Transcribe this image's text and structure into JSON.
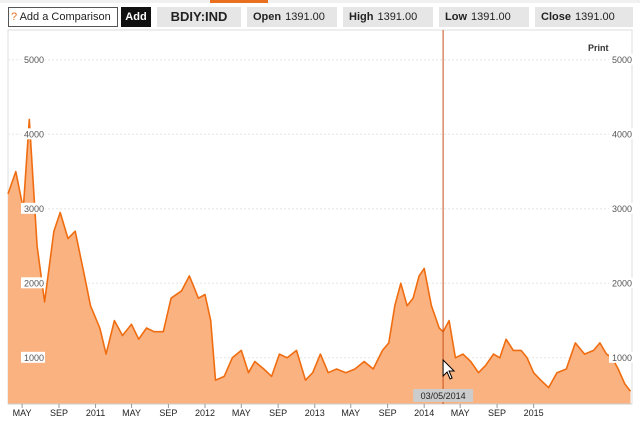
{
  "toolbar": {
    "help_icon": "?",
    "comparison_label": "Add a Comparison",
    "add_label": "Add",
    "ticker": "BDIY:IND",
    "open_label": "Open",
    "open_value": "1391.00",
    "high_label": "High",
    "high_value": "1391.00",
    "low_label": "Low",
    "low_value": "1391.00",
    "close_label": "Close",
    "close_value": "1391.00"
  },
  "print_label": "Print",
  "colors": {
    "accent": "#e8701f",
    "area_fill": "#fbb281",
    "line": "#ef6d10",
    "cursor": "#c8501a"
  },
  "chart_data": {
    "type": "area",
    "ylim": [
      380,
      5400
    ],
    "y_ticks": [
      1000,
      2000,
      3000,
      4000,
      5000
    ],
    "y_tick_labels": [
      "1000",
      "2000",
      "3000",
      "4000",
      "5000"
    ],
    "x_range": [
      "2010-03-15",
      "2015-11-25"
    ],
    "x_ticks": [
      "2010-05-01",
      "2010-09-01",
      "2011-01-01",
      "2011-05-01",
      "2011-09-01",
      "2012-01-01",
      "2012-05-01",
      "2012-09-01",
      "2013-01-01",
      "2013-05-01",
      "2013-09-01",
      "2014-01-01",
      "2014-05-01",
      "2014-09-01",
      "2015-01-01"
    ],
    "x_tick_labels": [
      "MAY",
      "SEP",
      "2011",
      "MAY",
      "SEP",
      "2012",
      "MAY",
      "SEP",
      "2013",
      "MAY",
      "SEP",
      "2014",
      "MAY",
      "SEP",
      "2015"
    ],
    "cursor": {
      "date": "2014-03-05",
      "label": "03/05/2014"
    },
    "x": [
      "2010-03-15",
      "2010-04-10",
      "2010-05-05",
      "2010-05-25",
      "2010-06-20",
      "2010-07-15",
      "2010-08-15",
      "2010-09-05",
      "2010-10-01",
      "2010-10-25",
      "2010-11-25",
      "2010-12-15",
      "2011-01-15",
      "2011-02-05",
      "2011-03-05",
      "2011-04-01",
      "2011-05-01",
      "2011-05-25",
      "2011-06-20",
      "2011-07-15",
      "2011-08-15",
      "2011-09-10",
      "2011-10-15",
      "2011-11-10",
      "2011-12-10",
      "2012-01-01",
      "2012-01-20",
      "2012-02-05",
      "2012-03-05",
      "2012-04-01",
      "2012-05-01",
      "2012-05-25",
      "2012-06-15",
      "2012-07-15",
      "2012-08-10",
      "2012-09-05",
      "2012-10-01",
      "2012-11-01",
      "2012-12-01",
      "2012-12-25",
      "2013-01-20",
      "2013-02-15",
      "2013-03-15",
      "2013-04-15",
      "2013-05-15",
      "2013-06-15",
      "2013-07-15",
      "2013-08-15",
      "2013-09-05",
      "2013-09-25",
      "2013-10-15",
      "2013-11-05",
      "2013-11-25",
      "2013-12-15",
      "2014-01-01",
      "2014-01-25",
      "2014-02-20",
      "2014-03-05",
      "2014-03-25",
      "2014-04-15",
      "2014-05-10",
      "2014-06-05",
      "2014-07-01",
      "2014-07-25",
      "2014-08-20",
      "2014-09-10",
      "2014-10-01",
      "2014-10-25",
      "2014-11-20",
      "2014-12-10",
      "2015-01-01",
      "2015-01-25",
      "2015-02-20",
      "2015-03-20",
      "2015-04-20",
      "2015-05-20",
      "2015-06-20",
      "2015-07-20",
      "2015-08-10",
      "2015-09-01",
      "2015-09-20",
      "2015-10-10",
      "2015-11-01",
      "2015-11-20"
    ],
    "values": [
      3200,
      3500,
      3000,
      4200,
      2500,
      1750,
      2700,
      2950,
      2600,
      2700,
      2100,
      1700,
      1400,
      1050,
      1500,
      1300,
      1450,
      1250,
      1400,
      1350,
      1350,
      1800,
      1900,
      2100,
      1800,
      1850,
      1500,
      700,
      750,
      1000,
      1100,
      800,
      950,
      850,
      750,
      1050,
      1000,
      1100,
      700,
      800,
      1050,
      800,
      850,
      800,
      850,
      950,
      850,
      1100,
      1200,
      1700,
      2000,
      1700,
      1800,
      2100,
      2200,
      1700,
      1400,
      1350,
      1500,
      1000,
      1050,
      950,
      800,
      900,
      1050,
      1000,
      1250,
      1100,
      1100,
      1000,
      800,
      700,
      600,
      800,
      850,
      1200,
      1050,
      1100,
      1200,
      1050,
      1000,
      850,
      650,
      550
    ]
  }
}
